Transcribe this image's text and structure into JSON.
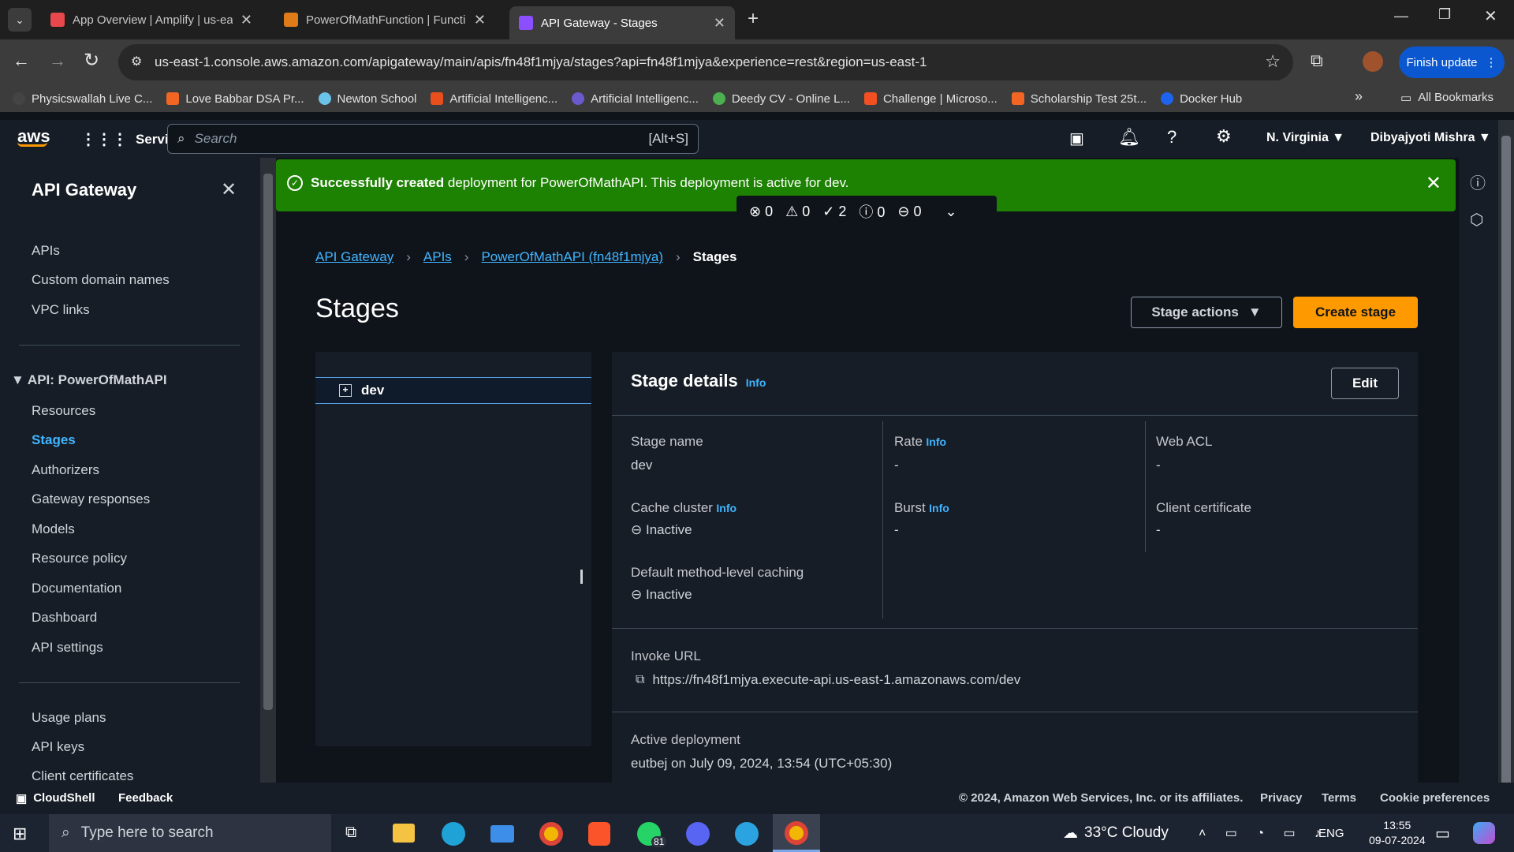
{
  "tabs": [
    {
      "title": "App Overview | Amplify | us-eas",
      "color": "#e8474b"
    },
    {
      "title": "PowerOfMathFunction | Functio",
      "color": "#e07b1a"
    },
    {
      "title": "API Gateway - Stages",
      "color": "#8c4fff"
    }
  ],
  "browser": {
    "url": "us-east-1.console.aws.amazon.com/apigateway/main/apis/fn48f1mjya/stages?api=fn48f1mjya&experience=rest&region=us-east-1",
    "finish_update": "Finish update"
  },
  "bookmarks": [
    {
      "label": "Physicswallah Live C...",
      "color": "#444"
    },
    {
      "label": "Love Babbar DSA Pr...",
      "color": "#f26522"
    },
    {
      "label": "Newton School",
      "color": "#6cc3e9"
    },
    {
      "label": "Artificial Intelligenc...",
      "color": "#e84f1c"
    },
    {
      "label": "Artificial Intelligenc...",
      "color": "#6a5acd"
    },
    {
      "label": "Deedy CV - Online L...",
      "color": "#4caf50"
    },
    {
      "label": "Challenge | Microso...",
      "color": "#f25022"
    },
    {
      "label": "Scholarship Test 25t...",
      "color": "#f26522"
    },
    {
      "label": "Docker Hub",
      "color": "#1d63ed"
    }
  ],
  "all_bookmarks": "All Bookmarks",
  "aws": {
    "logo": "aws",
    "services": "Services",
    "search_placeholder": "Search",
    "search_shortcut": "[Alt+S]",
    "region": "N. Virginia",
    "user": "Dibyajyoti Mishra"
  },
  "sidebar": {
    "title": "API Gateway",
    "top_items": [
      "APIs",
      "Custom domain names",
      "VPC links"
    ],
    "api_section": "API: PowerOfMathAPI",
    "api_items": [
      "Resources",
      "Stages",
      "Authorizers",
      "Gateway responses",
      "Models",
      "Resource policy",
      "Documentation",
      "Dashboard",
      "API settings"
    ],
    "bottom_items": [
      "Usage plans",
      "API keys",
      "Client certificates"
    ]
  },
  "flash": {
    "bold": "Successfully created",
    "text": " deployment for PowerOfMathAPI. This deployment is active for dev.",
    "counts": [
      "0",
      "0",
      "2",
      "0",
      "0"
    ]
  },
  "breadcrumb": [
    "API Gateway",
    "APIs",
    "PowerOfMathAPI (fn48f1mjya)",
    "Stages"
  ],
  "page": {
    "title": "Stages",
    "stage_actions": "Stage actions",
    "create_stage": "Create stage"
  },
  "tree": {
    "stage": "dev"
  },
  "details": {
    "title": "Stage details",
    "info": "Info",
    "edit": "Edit",
    "stage_name_label": "Stage name",
    "stage_name": "dev",
    "rate_label": "Rate",
    "rate": "-",
    "web_acl_label": "Web ACL",
    "web_acl": "-",
    "cache_label": "Cache cluster",
    "cache": "Inactive",
    "burst_label": "Burst",
    "burst": "-",
    "client_cert_label": "Client certificate",
    "client_cert": "-",
    "default_caching_label": "Default method-level caching",
    "default_caching": "Inactive",
    "invoke_label": "Invoke URL",
    "invoke_url": "https://fn48f1mjya.execute-api.us-east-1.amazonaws.com/dev",
    "active_deploy_label": "Active deployment",
    "active_deploy": "eutbej on July 09, 2024, 13:54 (UTC+05:30)"
  },
  "footer": {
    "cloudshell": "CloudShell",
    "feedback": "Feedback",
    "copyright": "© 2024, Amazon Web Services, Inc. or its affiliates.",
    "privacy": "Privacy",
    "terms": "Terms",
    "cookies": "Cookie preferences"
  },
  "taskbar": {
    "search": "Type here to search",
    "weather": "33°C  Cloudy",
    "lang": "ENG",
    "time": "13:55",
    "date": "09-07-2024",
    "whatsapp_badge": "81"
  }
}
